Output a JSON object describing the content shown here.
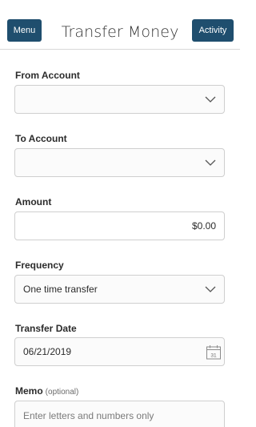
{
  "header": {
    "menu_label": "Menu",
    "title": "Transfer Money",
    "activity_label": "Activity"
  },
  "form": {
    "from_account": {
      "label": "From Account",
      "value": ""
    },
    "to_account": {
      "label": "To Account",
      "value": ""
    },
    "amount": {
      "label": "Amount",
      "value": "$0.00"
    },
    "frequency": {
      "label": "Frequency",
      "value": "One time transfer"
    },
    "transfer_date": {
      "label": "Transfer Date",
      "value": "06/21/2019",
      "calendar_day": "31"
    },
    "memo": {
      "label": "Memo",
      "optional_text": "(optional)",
      "placeholder": "Enter letters and numbers only"
    }
  },
  "colors": {
    "header_button": "#1f4e6e",
    "border": "#cfcfcf"
  },
  "icons": {
    "dropdown": "chevron-down-icon",
    "date": "calendar-icon"
  }
}
